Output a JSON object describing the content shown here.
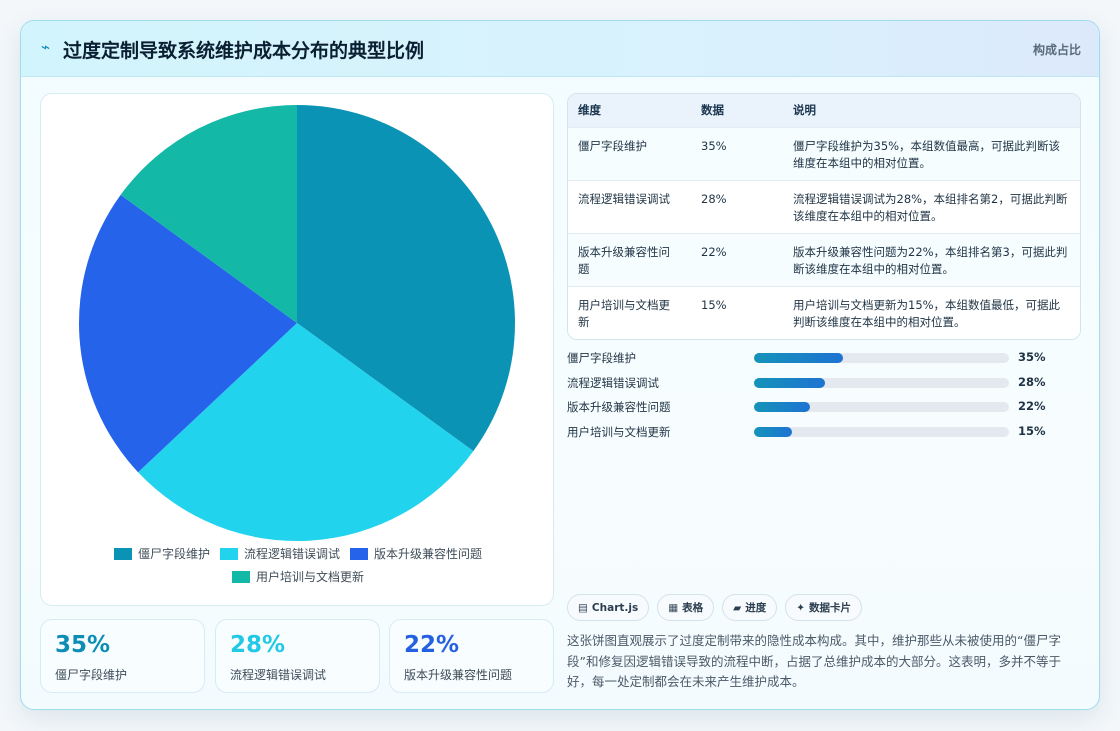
{
  "header": {
    "title": "过度定制导致系统维护成本分布的典型比例",
    "tag": "构成占比",
    "icon": "bolt-icon"
  },
  "chart_data": {
    "type": "pie",
    "categories": [
      "僵尸字段维护",
      "流程逻辑错误调试",
      "版本升级兼容性问题",
      "用户培训与文档更新"
    ],
    "values": [
      35,
      28,
      22,
      15
    ],
    "colors": [
      "#0b93b5",
      "#22d3ee",
      "#2563eb",
      "#14b8a6"
    ],
    "legend_position": "bottom"
  },
  "stats": [
    {
      "value": "35%",
      "label": "僵尸字段维护",
      "color": "#0b8db5"
    },
    {
      "value": "28%",
      "label": "流程逻辑错误调试",
      "color": "#22c9e6"
    },
    {
      "value": "22%",
      "label": "版本升级兼容性问题",
      "color": "#2460e0"
    }
  ],
  "table": {
    "headers": [
      "维度",
      "数据",
      "说明"
    ],
    "rows": [
      {
        "dim": "僵尸字段维护",
        "val": "35%",
        "note": "僵尸字段维护为35%，本组数值最高，可据此判断该维度在本组中的相对位置。"
      },
      {
        "dim": "流程逻辑错误调试",
        "val": "28%",
        "note": "流程逻辑错误调试为28%，本组排名第2，可据此判断该维度在本组中的相对位置。"
      },
      {
        "dim": "版本升级兼容性问题",
        "val": "22%",
        "note": "版本升级兼容性问题为22%，本组排名第3，可据此判断该维度在本组中的相对位置。"
      },
      {
        "dim": "用户培训与文档更新",
        "val": "15%",
        "note": "用户培训与文档更新为15%，本组数值最低，可据此判断该维度在本组中的相对位置。"
      }
    ]
  },
  "progress": [
    {
      "label": "僵尸字段维护",
      "pct": "35%",
      "fraction": 0.35
    },
    {
      "label": "流程逻辑错误调试",
      "pct": "28%",
      "fraction": 0.28
    },
    {
      "label": "版本升级兼容性问题",
      "pct": "22%",
      "fraction": 0.22
    },
    {
      "label": "用户培训与文档更新",
      "pct": "15%",
      "fraction": 0.15
    }
  ],
  "chips": [
    {
      "icon": "▤",
      "label": "Chart.js"
    },
    {
      "icon": "▦",
      "label": "表格"
    },
    {
      "icon": "▰",
      "label": "进度"
    },
    {
      "icon": "✦",
      "label": "数据卡片"
    }
  ],
  "description": "这张饼图直观展示了过度定制带来的隐性成本构成。其中，维护那些从未被使用的“僵尸字段”和修复因逻辑错误导致的流程中断，占据了总维护成本的大部分。这表明，多并不等于好，每一处定制都会在未来产生维护成本。"
}
